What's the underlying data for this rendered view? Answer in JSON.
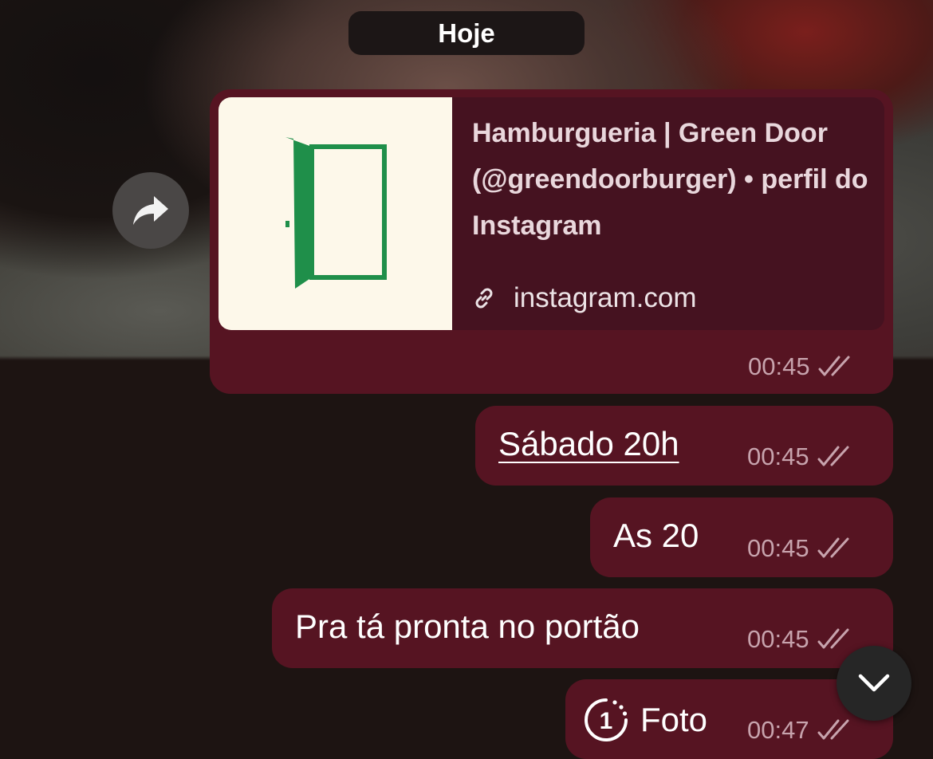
{
  "chat": {
    "date_divider": "Hoje",
    "link_preview": {
      "title": "Hamburgueria | Green Door (@greendoorburger) • perfil do Instagram",
      "domain": "instagram.com",
      "time": "00:45"
    },
    "messages": [
      {
        "text": "Sábado 20h",
        "time": "00:45"
      },
      {
        "text": "As 20",
        "time": "00:45"
      },
      {
        "text": "Pra tá pronta no portão",
        "time": "00:45"
      },
      {
        "text": "Foto",
        "time": "00:47",
        "view_once_count": "1"
      }
    ]
  },
  "icons": {
    "forward": "forward-arrow-icon",
    "link": "link-icon",
    "read_receipt": "double-check-icon",
    "view_once": "view-once-icon",
    "scroll_down": "chevron-down-icon"
  },
  "colors": {
    "outgoing_bubble": "#561422",
    "link_preview_panel": "#451220",
    "door_green": "#1f8f4a",
    "meta_text": "#c7a3ad"
  }
}
